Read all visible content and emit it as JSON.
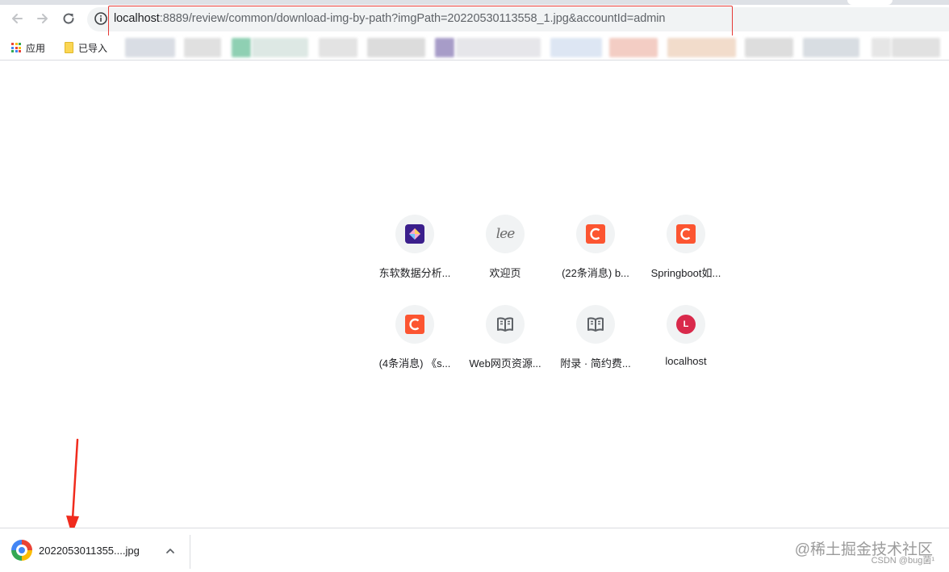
{
  "browser": {
    "url_host": "localhost",
    "url_rest": ":8889/review/common/download-img-by-path?imgPath=20220530113558_1.jpg&accountId=admin"
  },
  "nav": {
    "back_icon": "arrow-left-icon",
    "forward_icon": "arrow-right-icon",
    "reload_icon": "reload-icon",
    "info_icon": "info-icon"
  },
  "bookmarks": [
    {
      "label": "应用",
      "icon": "apps-grid-icon"
    },
    {
      "label": "已导入",
      "icon": "folder-icon"
    }
  ],
  "shortcuts": [
    {
      "title": "东软数据分析...",
      "icon": "neusoft-icon"
    },
    {
      "title": "欢迎页",
      "icon": "lee-logo-icon"
    },
    {
      "title": "(22条消息) b...",
      "icon": "csdn-icon"
    },
    {
      "title": "Springboot如...",
      "icon": "csdn-icon"
    },
    {
      "title": "(4条消息) 《s...",
      "icon": "csdn-icon"
    },
    {
      "title": "Web网页资源...",
      "icon": "book-icon"
    },
    {
      "title": "附录 · 简约费...",
      "icon": "book-icon"
    },
    {
      "title": "localhost",
      "icon": "localhost-letter-icon",
      "letter": "L"
    }
  ],
  "download": {
    "filename": "2022053011355....jpg",
    "icon": "image-viewer-icon"
  },
  "watermark": {
    "juejin": "@稀土掘金技术社区",
    "csdn": "CSDN @bug菌¹"
  },
  "colors": {
    "highlight_border": "#e53935",
    "annotation_arrow": "#f02b1d",
    "csdn_brand": "#fc5531"
  }
}
